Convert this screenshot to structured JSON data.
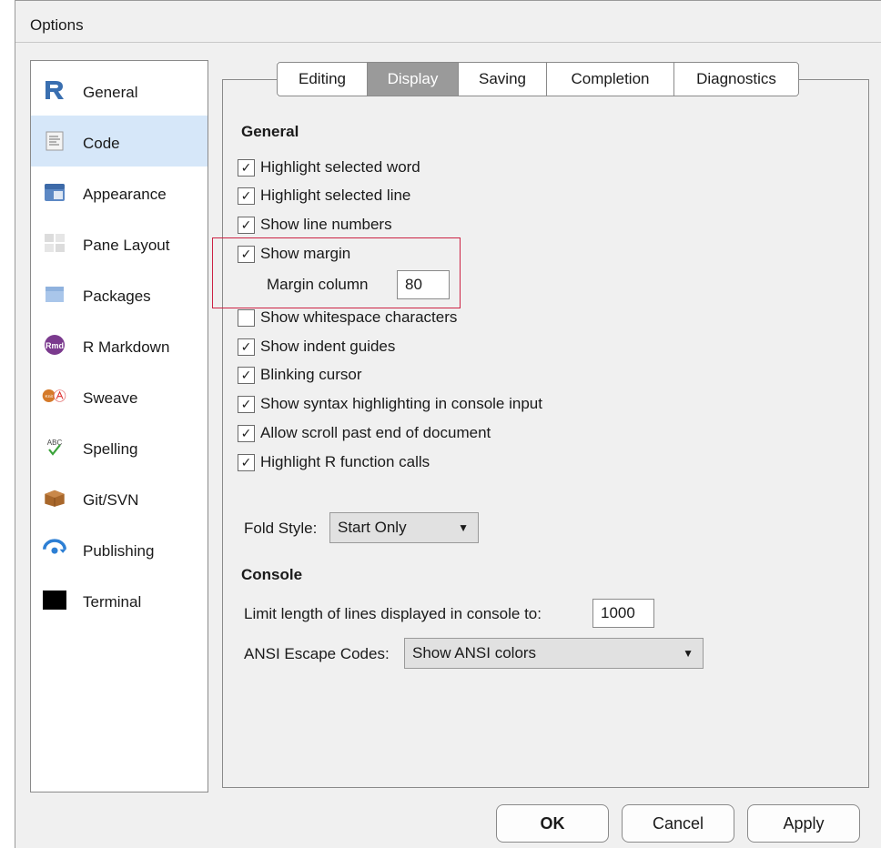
{
  "window": {
    "title": "Options"
  },
  "sidebar": {
    "items": [
      {
        "label": "General",
        "icon": "r-logo-icon"
      },
      {
        "label": "Code",
        "icon": "code-document-icon",
        "selected": true
      },
      {
        "label": "Appearance",
        "icon": "appearance-icon"
      },
      {
        "label": "Pane Layout",
        "icon": "pane-layout-icon"
      },
      {
        "label": "Packages",
        "icon": "packages-icon"
      },
      {
        "label": "R Markdown",
        "icon": "rmd-icon",
        "badge": "Rmd"
      },
      {
        "label": "Sweave",
        "icon": "sweave-icon",
        "badge": "Knit"
      },
      {
        "label": "Spelling",
        "icon": "spelling-icon",
        "badge": "ABC"
      },
      {
        "label": "Git/SVN",
        "icon": "git-box-icon"
      },
      {
        "label": "Publishing",
        "icon": "publishing-icon"
      },
      {
        "label": "Terminal",
        "icon": "terminal-icon"
      }
    ]
  },
  "tabs": [
    {
      "label": "Editing"
    },
    {
      "label": "Display",
      "active": true
    },
    {
      "label": "Saving"
    },
    {
      "label": "Completion"
    },
    {
      "label": "Diagnostics"
    }
  ],
  "general": {
    "heading": "General",
    "options": [
      {
        "label": "Highlight selected word",
        "checked": true
      },
      {
        "label": "Highlight selected line",
        "checked": true
      },
      {
        "label": "Show line numbers",
        "checked": true
      },
      {
        "label": "Show margin",
        "checked": true
      },
      {
        "label": "Show whitespace characters",
        "checked": false
      },
      {
        "label": "Show indent guides",
        "checked": true
      },
      {
        "label": "Blinking cursor",
        "checked": true
      },
      {
        "label": "Show syntax highlighting in console input",
        "checked": true
      },
      {
        "label": "Allow scroll past end of document",
        "checked": true
      },
      {
        "label": "Highlight R function calls",
        "checked": true
      }
    ],
    "margin_column_label": "Margin column",
    "margin_column_value": "80",
    "fold_style_label": "Fold Style:",
    "fold_style_value": "Start Only"
  },
  "console": {
    "heading": "Console",
    "limit_label": "Limit length of lines displayed in console to:",
    "limit_value": "1000",
    "ansi_label": "ANSI Escape Codes:",
    "ansi_value": "Show ANSI colors"
  },
  "buttons": {
    "ok": "OK",
    "cancel": "Cancel",
    "apply": "Apply"
  },
  "colors": {
    "selected_bg": "#d6e7f9",
    "highlight_box": "#cc2244",
    "active_tab": "#9a9a9a"
  },
  "check_glyph": "✓",
  "dropdown_glyph": "▼"
}
